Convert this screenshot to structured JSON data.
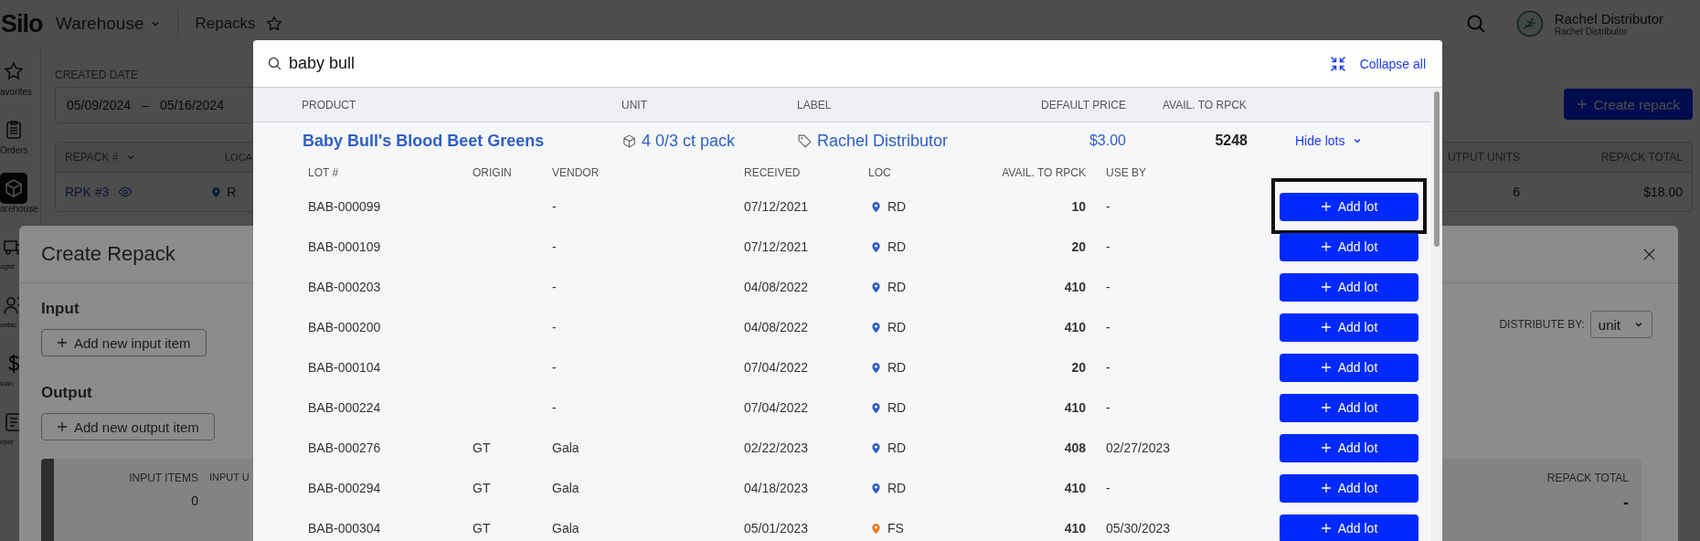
{
  "app_header": {
    "logo": "Silo",
    "section": "Warehouse",
    "page": "Repacks",
    "user_name": "Rachel Distributor",
    "user_org": "Rachel Distributor"
  },
  "sidebar": {
    "items": [
      {
        "kind": "star",
        "label": "avorites",
        "selected": false
      },
      {
        "kind": "clipboard",
        "label": "Orders",
        "selected": false
      },
      {
        "kind": "box",
        "label": "arehouse",
        "selected": true
      },
      {
        "kind": "truck",
        "label": "ogist",
        "selected": false
      },
      {
        "kind": "people",
        "label": "ontac",
        "selected": false
      },
      {
        "kind": "dollar",
        "label": "inan",
        "selected": false
      },
      {
        "kind": "report",
        "label": "epor",
        "selected": false
      }
    ]
  },
  "filters": {
    "created_date_label": "CREATED DATE",
    "date_from": "05/09/2024",
    "date_separator": "–",
    "date_to": "05/16/2024"
  },
  "create_button": "Create repack",
  "repacks_table": {
    "columns": [
      "REPACK #",
      "LOCA",
      "UTPUT UNITS",
      "REPACK TOTAL"
    ],
    "rows": [
      {
        "repack": "RPK #3",
        "location": "R",
        "output_units": "6",
        "total": "$18.00"
      }
    ]
  },
  "create_repack_dialog": {
    "title": "Create Repack",
    "input_heading": "Input",
    "add_input_button": "Add new input item",
    "output_heading": "Output",
    "add_output_button": "Add new output item",
    "distribute_label": "DISTRIBUTE BY:",
    "distribute_value": "unit",
    "summary": {
      "columns": [
        {
          "label": "INPUT ITEMS",
          "value": "0"
        },
        {
          "label": "INPUT U"
        }
      ],
      "total_label": "REPACK TOTAL",
      "total_value": "-"
    }
  },
  "lot_search": {
    "query": "baby bull",
    "collapse_all": "Collapse all",
    "columns": [
      "PRODUCT",
      "UNIT",
      "LABEL",
      "DEFAULT PRICE",
      "AVAIL. TO RPCK"
    ],
    "product": {
      "name": "Baby Bull's Blood Beet Greens",
      "unit": "4 0/3 ct pack",
      "label": "Rachel Distributor",
      "price": "$3.00",
      "available": "5248",
      "lots_toggle": "Hide lots",
      "expanded": true
    },
    "lot_columns": [
      "LOT #",
      "ORIGIN",
      "VENDOR",
      "RECEIVED",
      "LOC",
      "AVAIL. TO RPCK",
      "USE BY"
    ],
    "lots": [
      {
        "lot": "BAB-000099",
        "vendor": "-",
        "received": "07/12/2021",
        "loc": "RD",
        "color": "#2f5fc4",
        "available": "10",
        "use_by": "-",
        "button": "Add lot",
        "highlighted": true
      },
      {
        "lot": "BAB-000109",
        "vendor": "-",
        "received": "07/12/2021",
        "loc": "RD",
        "color": "#2f5fc4",
        "available": "20",
        "use_by": "-",
        "button": "Add lot",
        "highlighted": false
      },
      {
        "lot": "BAB-000203",
        "vendor": "-",
        "received": "04/08/2022",
        "loc": "RD",
        "color": "#2f5fc4",
        "available": "410",
        "use_by": "-",
        "button": "Add lot",
        "highlighted": false
      },
      {
        "lot": "BAB-000200",
        "vendor": "-",
        "received": "04/08/2022",
        "loc": "RD",
        "color": "#2f5fc4",
        "available": "410",
        "use_by": "-",
        "button": "Add lot",
        "highlighted": false
      },
      {
        "lot": "BAB-000104",
        "vendor": "-",
        "received": "07/04/2022",
        "loc": "RD",
        "color": "#2f5fc4",
        "available": "20",
        "use_by": "-",
        "button": "Add lot",
        "highlighted": false
      },
      {
        "lot": "BAB-000224",
        "vendor": "-",
        "received": "07/04/2022",
        "loc": "RD",
        "color": "#2f5fc4",
        "available": "410",
        "use_by": "-",
        "button": "Add lot",
        "highlighted": false
      },
      {
        "lot": "BAB-000276",
        "origin": "GT",
        "vendor": "Gala",
        "received": "02/22/2023",
        "loc": "RD",
        "color": "#2f5fc4",
        "available": "408",
        "use_by": "02/27/2023",
        "button": "Add lot",
        "highlighted": false
      },
      {
        "lot": "BAB-000294",
        "origin": "GT",
        "vendor": "Gala",
        "received": "04/18/2023",
        "loc": "RD",
        "color": "#2f5fc4",
        "available": "410",
        "use_by": "-",
        "button": "Add lot",
        "highlighted": false
      },
      {
        "lot": "BAB-000304",
        "origin": "GT",
        "vendor": "Gala",
        "received": "05/01/2023",
        "loc": "FS",
        "color": "#f07c1f",
        "available": "410",
        "use_by": "05/30/2023",
        "button": "Add lot",
        "highlighted": false
      }
    ]
  }
}
